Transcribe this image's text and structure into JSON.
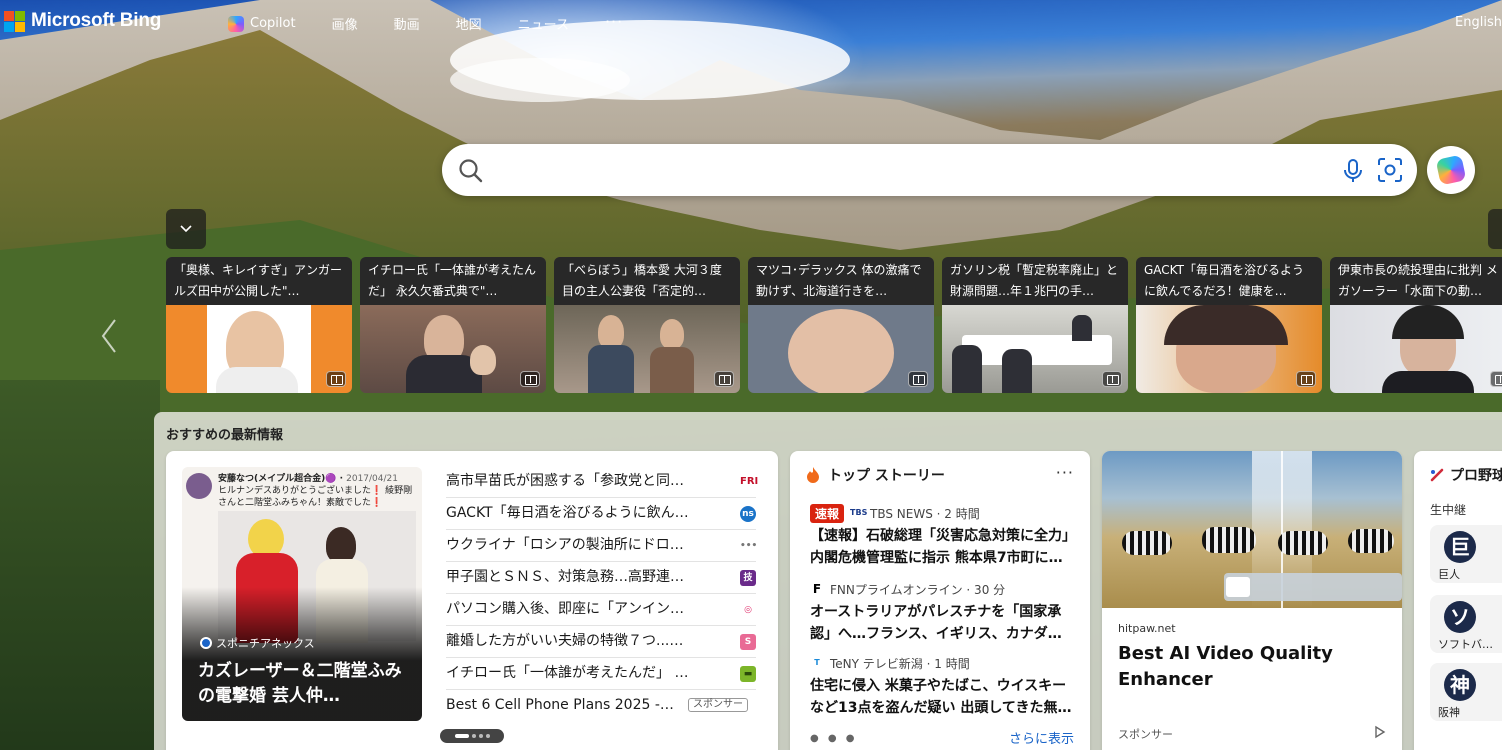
{
  "brand": {
    "name": "Microsoft Bing",
    "colors": [
      "#f25022",
      "#7fba00",
      "#00a4ef",
      "#ffb900"
    ]
  },
  "nav": {
    "copilot": "Copilot",
    "items": [
      "画像",
      "動画",
      "地図",
      "ニュース"
    ],
    "more": "···",
    "language": "English"
  },
  "search": {
    "value": "",
    "placeholder": ""
  },
  "carousel": [
    {
      "caption": "「奥様、キレイすぎ」アンガールズ田中が公開した\"…"
    },
    {
      "caption": "イチロー氏「一体誰が考えたんだ」 永久欠番式典で\"…"
    },
    {
      "caption": "「べらぼう」橋本愛 大河３度目の主人公妻役「否定的…"
    },
    {
      "caption": "マツコ･デラックス 体の激痛で動けず、北海道行きを…"
    },
    {
      "caption": "ガソリン税「暫定税率廃止」と財源問題…年１兆円の手…"
    },
    {
      "caption": "GACKT「毎日酒を浴びるように飲んでるだろ！健康を…"
    },
    {
      "caption": "伊東市長の続投理由に批判 メガソーラー「水面下の動…"
    }
  ],
  "panel": {
    "title": "おすすめの最新情報"
  },
  "featured": {
    "tweet_name": "安藤なつ(メイプル超合金)🟣",
    "tweet_date": "2017/04/21",
    "tweet_text": "ヒルナンデスありがとうございました❗ 綾野剛さんと二階堂ふみちゃん！素敵でした❗",
    "source": "スポニチアネックス",
    "title": "カズレーザー＆二階堂ふみの電撃婚 芸人仲…"
  },
  "headlines": [
    {
      "text": "高市早苗氏が困惑する「参政党と同…",
      "pub": "FRI",
      "color": "#ffffff",
      "fg": "#c4102b"
    },
    {
      "text": "GACKT「毎日酒を浴びるように飲ん…",
      "pub": "ns",
      "color": "#1a73c8",
      "fg": "#ffffff"
    },
    {
      "text": "ウクライナ「ロシアの製油所にドロ…",
      "pub": "•••",
      "color": "#ffffff",
      "fg": "#777777"
    },
    {
      "text": "甲子園とＳＮＳ、対策急務…高野連…",
      "pub": "技",
      "color": "#6a2a8a",
      "fg": "#ffffff"
    },
    {
      "text": "パソコン購入後、即座に「アンイン…",
      "pub": "◎",
      "color": "#ffffff",
      "fg": "#e0336e"
    },
    {
      "text": "離婚した方がいい夫婦の特徴７つ...…",
      "pub": "S",
      "color": "#e96a95",
      "fg": "#ffffff"
    },
    {
      "text": "イチロー氏「一体誰が考えたんだ」 …",
      "pub": "▬",
      "color": "#7cb529",
      "fg": "#2a4a0a"
    },
    {
      "text": "Best 6 Cell Phone Plans 2025 - …",
      "pub": "",
      "color": "",
      "fg": "",
      "sponsor": "スポンサー"
    }
  ],
  "top_stories": {
    "title": "トップ ストーリー",
    "more": "···",
    "items": [
      {
        "tag": "速報",
        "source": "TBS NEWS · 2 時間",
        "text": "【速報】石破総理「災害応急対策に全力」内閣危機管理監に指示 熊本県7市町に…"
      },
      {
        "tag": "",
        "source": "FNNプライムオンライン · 30 分",
        "text": "オーストラリアがパレスチナを「国家承認」へ…フランス、イギリス、カナダ…"
      },
      {
        "tag": "",
        "source": "TeNY テレビ新潟 · 1 時間",
        "text": "住宅に侵入 米菓子やたばこ、ウイスキーなど13点を盗んだ疑い 出頭してきた無…"
      }
    ],
    "see_more": "さらに表示"
  },
  "ad": {
    "source": "hitpaw.net",
    "title": "Best AI Video Quality Enhancer",
    "sponsor": "スポンサー"
  },
  "baseball": {
    "title": "プロ野球",
    "live": "生中継",
    "teams": [
      {
        "logo": "巨",
        "name": "巨人"
      },
      {
        "logo": "ソ",
        "name": "ソフトバ…"
      },
      {
        "logo": "神",
        "name": "阪神"
      }
    ]
  }
}
